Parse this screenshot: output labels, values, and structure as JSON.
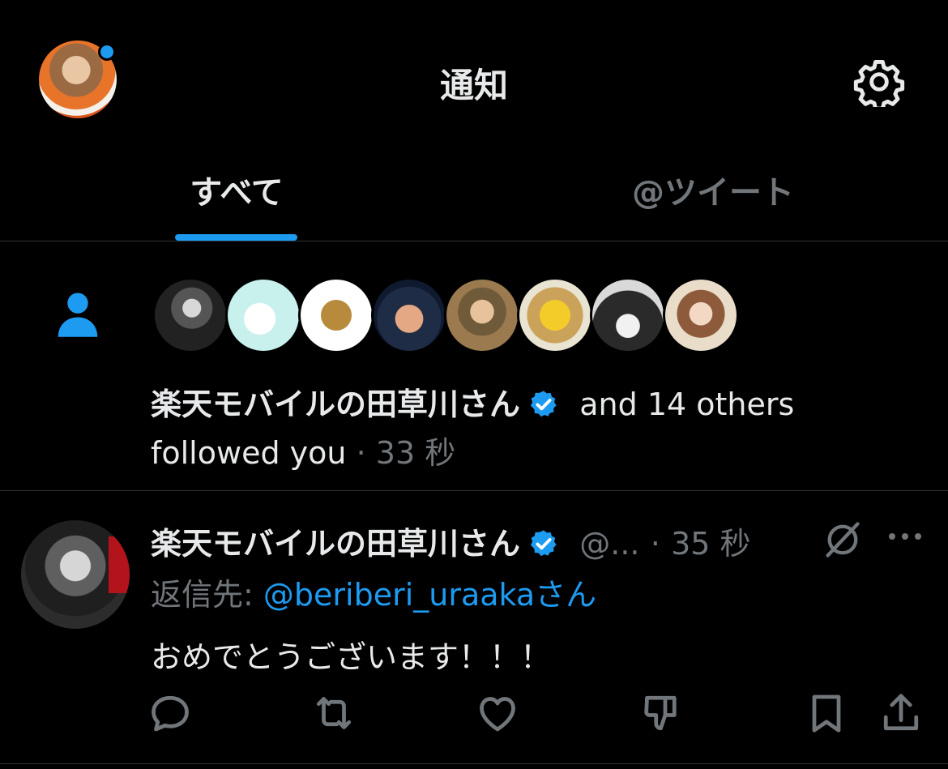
{
  "header": {
    "title": "通知"
  },
  "tabs": [
    {
      "label": "すべて",
      "active": true
    },
    {
      "label": "@ツイート",
      "active": false
    }
  ],
  "follow_notification": {
    "name": "楽天モバイルの田草川さん",
    "and_others": "and 14 others",
    "followed_text": "followed you",
    "separator": "·",
    "time": "33 秒",
    "follower_avatar_count": 8
  },
  "tweet": {
    "author_name": "楽天モバイルの田草川さん",
    "handle": "@...",
    "separator": "·",
    "time": "35 秒",
    "reply_prefix": "返信先:",
    "reply_to": "@beriberi_uraaka",
    "reply_suffix": "さん",
    "body": "おめでとうございます！！！"
  },
  "colors": {
    "accent": "#1d9bf0",
    "background": "#000000",
    "text": "#e7e9ea",
    "muted": "#71767b",
    "divider": "#2f3336"
  }
}
